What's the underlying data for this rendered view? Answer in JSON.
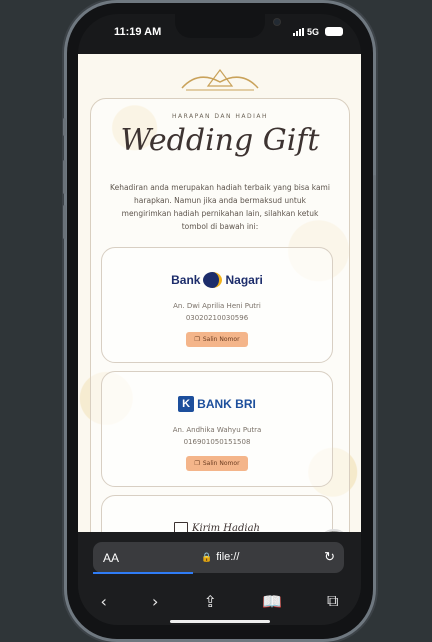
{
  "status": {
    "time": "11:19 AM",
    "network": "5G"
  },
  "page": {
    "kicker": "HARAPAN DAN HADIAH",
    "title": "Wedding Gift",
    "description": "Kehadiran anda merupakan hadiah terbaik yang bisa kami harapkan. Namun jika anda bermaksud untuk mengirimkan hadiah pernikahan lain, silahkan ketuk tombol di bawah ini:",
    "banks": [
      {
        "logo_text_1": "Bank",
        "logo_text_2": "Nagari",
        "holder": "An. Dwi Aprilia Heni Putri",
        "number": "03020210030596",
        "copy_label": "Salin Nomor"
      },
      {
        "logo_text": "BANK BRI",
        "holder": "An. Andhika Wahyu Putra",
        "number": "016901050151508",
        "copy_label": "Salin Nomor"
      }
    ],
    "gift_section": {
      "label": "Kirim Hadiah"
    }
  },
  "browser": {
    "text_size_label": "AA",
    "url": "file://",
    "colors": {
      "progress": "#2f7cf6",
      "copy_button": "#f4b58a",
      "bri_blue": "#1d4f9c"
    }
  }
}
